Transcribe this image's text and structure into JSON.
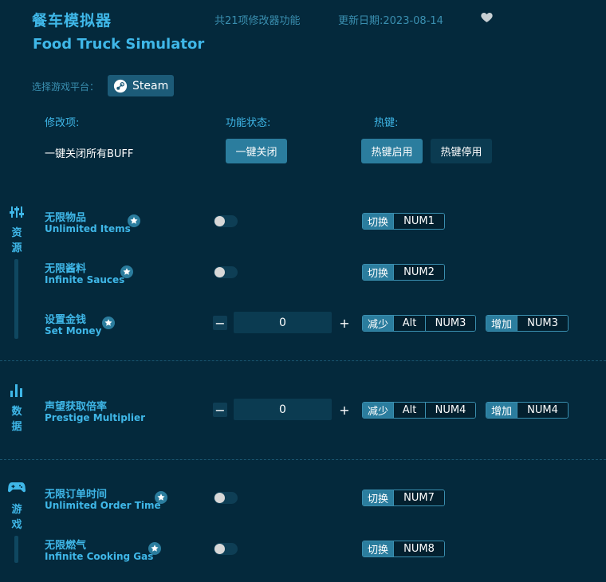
{
  "header": {
    "title_cn": "餐车模拟器",
    "title_en": "Food Truck Simulator",
    "feature_count": "共21项修改器功能",
    "update_date": "更新日期:2023-08-14",
    "favorite_icon": "heart-icon"
  },
  "platform": {
    "label": "选择游戏平台：",
    "selected": "Steam",
    "icon": "steam-icon"
  },
  "columns": {
    "mod": "修改项:",
    "status": "功能状态:",
    "hotkey": "热键:"
  },
  "global": {
    "label": "一键关闭所有BUFF",
    "close_all": "一键关闭",
    "hotkey_enable": "热键启用",
    "hotkey_disable": "热键停用"
  },
  "sections": [
    {
      "name": "资源",
      "icon": "sliders-icon"
    },
    {
      "name": "数据",
      "icon": "bar-chart-icon"
    },
    {
      "name": "游戏",
      "icon": "gamepad-icon"
    }
  ],
  "cheats": {
    "unlimited_items": {
      "cn": "无限物品",
      "en": "Unlimited Items",
      "enabled": false,
      "hotkey_tag": "切换",
      "hotkey": "NUM1"
    },
    "infinite_sauces": {
      "cn": "无限酱料",
      "en": "Infinite Sauces",
      "enabled": false,
      "hotkey_tag": "切换",
      "hotkey": "NUM2"
    },
    "set_money": {
      "cn": "设置金钱",
      "en": "Set Money",
      "value": "0",
      "dec_tag": "减少",
      "dec_mod": "Alt",
      "dec_key": "NUM3",
      "inc_tag": "增加",
      "inc_key": "NUM3"
    },
    "prestige_multiplier": {
      "cn": "声望获取倍率",
      "en": "Prestige Multiplier",
      "value": "0",
      "dec_tag": "减少",
      "dec_mod": "Alt",
      "dec_key": "NUM4",
      "inc_tag": "增加",
      "inc_key": "NUM4"
    },
    "unlimited_order_time": {
      "cn": "无限订单时间",
      "en": "Unlimited Order Time",
      "enabled": false,
      "hotkey_tag": "切换",
      "hotkey": "NUM7"
    },
    "infinite_cooking_gas": {
      "cn": "无限燃气",
      "en": "Infinite Cooking Gas",
      "enabled": false,
      "hotkey_tag": "切换",
      "hotkey": "NUM8"
    }
  },
  "stepper": {
    "minus": "−",
    "plus": "+"
  },
  "colors": {
    "background": "#04293c",
    "accent": "#3fb7e8",
    "button": "#2b7d9e",
    "button_dark": "#0b3b51"
  }
}
